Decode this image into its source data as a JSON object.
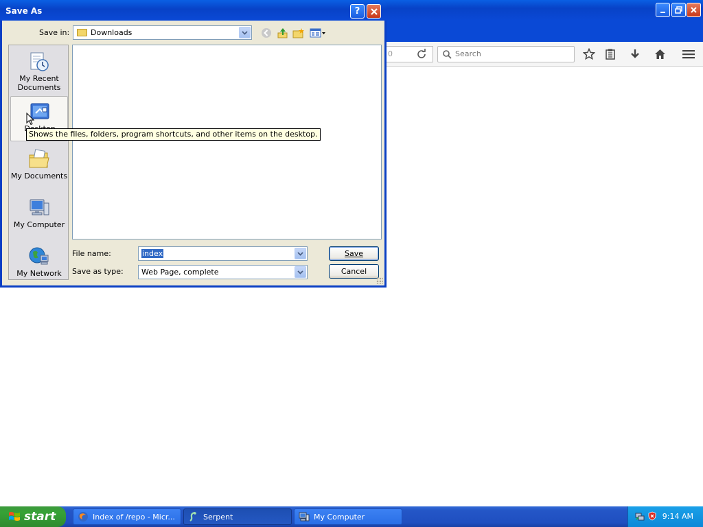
{
  "browser": {
    "url_fragment": "0",
    "search_placeholder": "Search"
  },
  "dialog": {
    "title": "Save As",
    "save_in_label": "Save in:",
    "save_in_value": "Downloads",
    "places": [
      {
        "label": "My Recent Documents",
        "icon": "recent-documents-icon"
      },
      {
        "label": "Desktop",
        "icon": "desktop-icon"
      },
      {
        "label": "My Documents",
        "icon": "my-documents-icon"
      },
      {
        "label": "My Computer",
        "icon": "my-computer-icon"
      },
      {
        "label": "My Network",
        "icon": "my-network-icon"
      }
    ],
    "file_name_label": "File name:",
    "file_name_value": "index",
    "save_as_type_label": "Save as type:",
    "save_as_type_value": "Web Page, complete",
    "save_button": "Save",
    "cancel_button": "Cancel",
    "tooltip": "Shows the files, folders, program shortcuts, and other items on the desktop."
  },
  "taskbar": {
    "start_label": "start",
    "tasks": [
      {
        "label": "Index of /repo - Micr...",
        "icon": "firefox-icon"
      },
      {
        "label": "Serpent",
        "icon": "serpent-icon"
      },
      {
        "label": "My Computer",
        "icon": "my-computer-icon"
      }
    ],
    "clock": "9:14 AM"
  },
  "colors": {
    "xp_blue": "#0a49d6",
    "dialog_bg": "#ece9d8",
    "start_green": "#36a236",
    "tooltip_bg": "#ffffe1"
  }
}
